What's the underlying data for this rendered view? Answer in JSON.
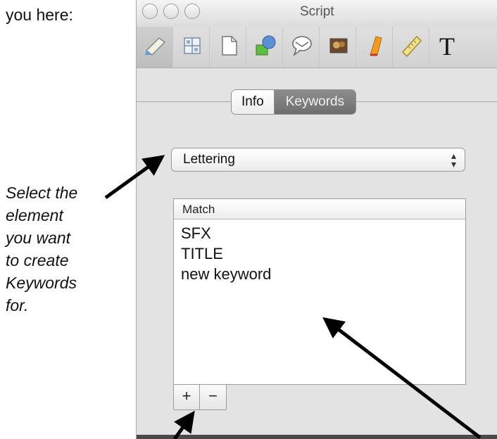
{
  "captions": {
    "top": "you here:",
    "side": [
      "Select the",
      "element",
      "you want",
      "to create",
      "Keywords",
      "for."
    ]
  },
  "window": {
    "title": "Script",
    "toolbar_icons": [
      "pencil-tool-icon",
      "grid-icon",
      "page-icon",
      "shapes-icon",
      "speech-balloon-icon",
      "image-icon",
      "marker-icon",
      "ruler-icon",
      "text-tool-icon"
    ]
  },
  "tabs": {
    "info": "Info",
    "keywords": "Keywords",
    "selected": "Keywords"
  },
  "element_popup": {
    "value": "Lettering",
    "arrows": "⌃⌄"
  },
  "keyword_table": {
    "header": "Match",
    "rows": [
      "SFX",
      "TITLE",
      "new keyword"
    ]
  },
  "buttons": {
    "add": "+",
    "remove": "−"
  },
  "colors": {
    "segment_active": "#7a7a7a",
    "arrow": "#000000"
  }
}
